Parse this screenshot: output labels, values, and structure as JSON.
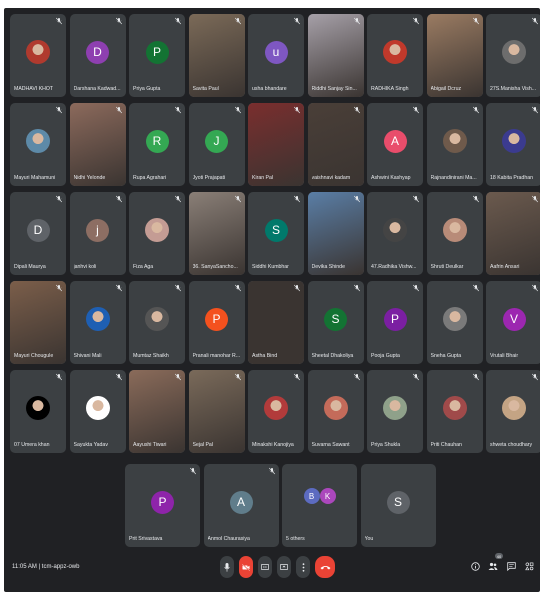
{
  "participants": [
    {
      "name": "MADHAVI KHOT",
      "kind": "photo",
      "color": "#b03a2e"
    },
    {
      "name": "Darshana Kadwad...",
      "kind": "letter",
      "letter": "D",
      "color": "#8e3fb0"
    },
    {
      "name": "Priya Gupta",
      "kind": "letter",
      "letter": "P",
      "color": "#137333"
    },
    {
      "name": "Savita Paul",
      "kind": "video",
      "color": "#7b6a58"
    },
    {
      "name": "usha bhandare",
      "kind": "letter",
      "letter": "u",
      "color": "#7e57c2"
    },
    {
      "name": "Riddhi Sanjay Sin...",
      "kind": "video",
      "color": "#a6a0a8"
    },
    {
      "name": "RADHIKA Singh",
      "kind": "photo",
      "color": "#c0392b"
    },
    {
      "name": "Abigail Dcruz",
      "kind": "video",
      "color": "#9a7b62"
    },
    {
      "name": "27S.Manisha Vish...",
      "kind": "photo",
      "color": "#6d6d6d"
    },
    {
      "name": "Mayuri Mahamuni",
      "kind": "photo",
      "color": "#5d8aa8"
    },
    {
      "name": "Nidhi Yelonde",
      "kind": "video",
      "color": "#8c6a5c"
    },
    {
      "name": "Rupa Agrahari",
      "kind": "letter",
      "letter": "R",
      "color": "#34a853"
    },
    {
      "name": "Jyoti Prajapati",
      "kind": "letter",
      "letter": "J",
      "color": "#34a853"
    },
    {
      "name": "Kiran Pal",
      "kind": "video",
      "color": "#7a2e2e"
    },
    {
      "name": "vaishnavi kadam",
      "kind": "video",
      "color": "#4a3f38"
    },
    {
      "name": "Ashwini Kashyap",
      "kind": "letter",
      "letter": "A",
      "color": "#e94d6b"
    },
    {
      "name": "Rajnandinirani Ma...",
      "kind": "photo",
      "color": "#6f5a4b"
    },
    {
      "name": "18 Kabita Pradhan",
      "kind": "photo",
      "color": "#3b3b8f"
    },
    {
      "name": "Dipali Maurya",
      "kind": "letter",
      "letter": "D",
      "color": "#5f6368"
    },
    {
      "name": "janhvi koli",
      "kind": "letter",
      "letter": "j",
      "color": "#8d6e63"
    },
    {
      "name": "Fiza Aga",
      "kind": "photo",
      "color": "#c49c94"
    },
    {
      "name": "36. SanyaSancho...",
      "kind": "video",
      "color": "#8a7f77"
    },
    {
      "name": "Siddhi Kumbhar",
      "kind": "letter",
      "letter": "S",
      "color": "#00796b"
    },
    {
      "name": "Devika Shinde",
      "kind": "video",
      "color": "#5a7ea6"
    },
    {
      "name": "47.Radhika Vishw...",
      "kind": "photo",
      "color": "#444"
    },
    {
      "name": "Shruti Deulkar",
      "kind": "photo",
      "color": "#b88b78"
    },
    {
      "name": "Aafrin Ansari",
      "kind": "video",
      "color": "#6b5a4e"
    },
    {
      "name": "Mayuri Chougule",
      "kind": "video",
      "color": "#7b5e4a"
    },
    {
      "name": "Shivani Mali",
      "kind": "photo",
      "color": "#1e5fb3"
    },
    {
      "name": "Mumtaz Shaikh",
      "kind": "photo",
      "color": "#555"
    },
    {
      "name": "Pranali manohar R...",
      "kind": "letter",
      "letter": "P",
      "color": "#f4511e"
    },
    {
      "name": "Astha Bind",
      "kind": "video",
      "color": "#3a3431"
    },
    {
      "name": "Sheetal Dhakoliya",
      "kind": "letter",
      "letter": "S",
      "color": "#137333"
    },
    {
      "name": "Pooja Gupta",
      "kind": "letter",
      "letter": "P",
      "color": "#7b1fa2"
    },
    {
      "name": "Sneha Gupta",
      "kind": "photo",
      "color": "#7a7a7a"
    },
    {
      "name": "Vrutali Bhair",
      "kind": "letter",
      "letter": "V",
      "color": "#9c27b0"
    },
    {
      "name": "07 Umera khan",
      "kind": "photo",
      "color": "#000000"
    },
    {
      "name": "Sayukta Yadav",
      "kind": "photo",
      "color": "#ffffff"
    },
    {
      "name": "Aayushi Tiwari",
      "kind": "video",
      "color": "#8a6b5a"
    },
    {
      "name": "Sejal Pal",
      "kind": "video",
      "color": "#7a6a5a"
    },
    {
      "name": "Minakshi Kanojiya",
      "kind": "photo",
      "color": "#b23b3b"
    },
    {
      "name": "Suvarna Sawant",
      "kind": "photo",
      "color": "#c46b5a"
    },
    {
      "name": "Priya Shukla",
      "kind": "photo",
      "color": "#8fa18a"
    },
    {
      "name": "Priti Chauhan",
      "kind": "photo",
      "color": "#a04a4a"
    },
    {
      "name": "shweta choudhary",
      "kind": "photo",
      "color": "#c4a484"
    }
  ],
  "last_row": [
    {
      "name": "Prit Srivastava",
      "kind": "letter",
      "letter": "P",
      "color": "#8e24aa"
    },
    {
      "name": "Anmol Chaurasiya",
      "kind": "letter",
      "letter": "A",
      "color": "#607d8b"
    },
    {
      "name": "5 others",
      "kind": "others",
      "letters": [
        "B",
        "K"
      ],
      "colors": [
        "#5c6bc0",
        "#ab47bc"
      ]
    },
    {
      "name": "You",
      "kind": "letter",
      "letter": "S",
      "color": "#5f6368"
    }
  ],
  "bottom_bar": {
    "time_and_code": "11:05 AM  |  tcm-appz-owb",
    "participant_count": "40"
  },
  "controls": [
    "mic-button",
    "camera-off-button",
    "captions-button",
    "present-button",
    "more-options-button",
    "leave-call-button"
  ],
  "right_controls": [
    "info-button",
    "people-button",
    "chat-button",
    "activities-button"
  ]
}
